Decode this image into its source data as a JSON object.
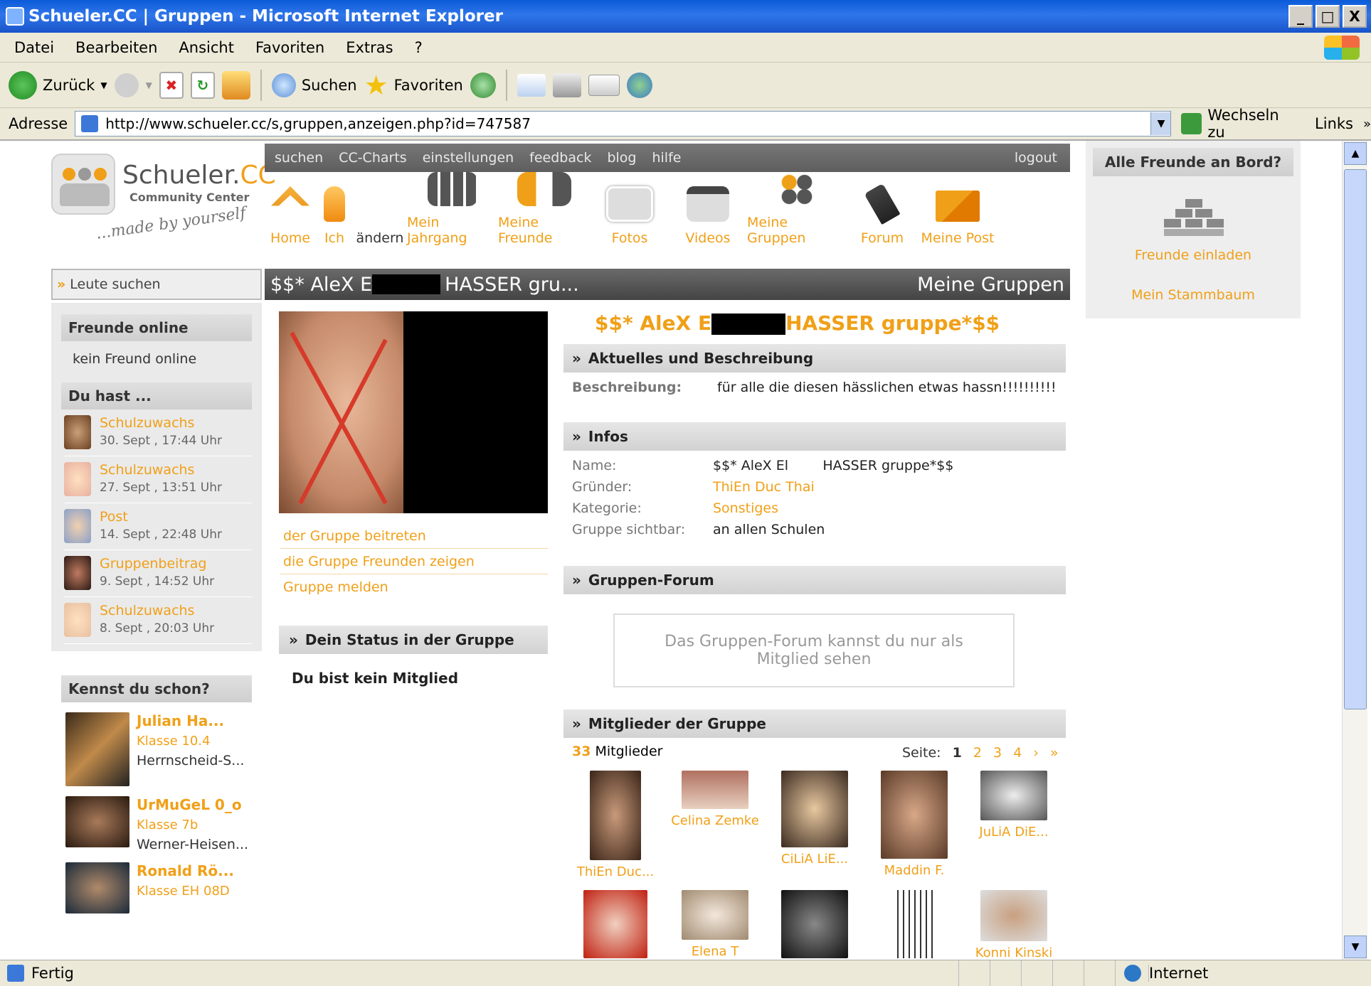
{
  "window": {
    "title": "Schueler.CC | Gruppen - Microsoft Internet Explorer",
    "min": "_",
    "max": "□",
    "close": "X"
  },
  "menu": [
    "Datei",
    "Bearbeiten",
    "Ansicht",
    "Favoriten",
    "Extras",
    "?"
  ],
  "toolbar": {
    "back": "Zurück",
    "search": "Suchen",
    "favorites": "Favoriten"
  },
  "address": {
    "label": "Adresse",
    "url": "http://www.schueler.cc/s,gruppen,anzeigen.php?id=747587",
    "go": "Wechseln zu",
    "links": "Links"
  },
  "status": {
    "text": "Fertig",
    "zone": "Internet"
  },
  "site": {
    "logo": {
      "name": "Schueler.",
      "cc": "CC",
      "sub": "Community Center",
      "slogan": "...made by yourself"
    },
    "topnav": [
      "suchen",
      "CC-Charts",
      "einstellungen",
      "feedback",
      "blog",
      "hilfe"
    ],
    "logout": "logout",
    "iconnav": [
      "Home",
      "Ich",
      "ändern",
      "Mein Jahrgang",
      "Meine Freunde",
      "Fotos",
      "Videos",
      "Meine Gruppen",
      "Forum",
      "Meine Post"
    ],
    "search_placeholder": "Leute suchen",
    "header_title_a": "$$* AleX E",
    "header_title_b": "HASSER gru...",
    "header_right": "Meine Gruppen"
  },
  "left": {
    "online_title": "Freunde online",
    "online_text": "kein Freund online",
    "duhast_title": "Du hast ...",
    "activities": [
      {
        "type": "Schulzuwachs",
        "time": "30. Sept , 17:44 Uhr"
      },
      {
        "type": "Schulzuwachs",
        "time": "27. Sept , 13:51 Uhr"
      },
      {
        "type": "Post",
        "time": "14. Sept , 22:48 Uhr"
      },
      {
        "type": "Gruppenbeitrag",
        "time": "9. Sept , 14:52 Uhr"
      },
      {
        "type": "Schulzuwachs",
        "time": "8. Sept , 20:03 Uhr"
      }
    ],
    "kennst_title": "Kennst du schon?",
    "people": [
      {
        "name": "Julian Ha...",
        "klasse": "Klasse 10.4",
        "school": "Herrnscheid-S..."
      },
      {
        "name": "UrMuGeL 0_o",
        "klasse": "Klasse 7b",
        "school": "Werner-Heisen..."
      },
      {
        "name": "Ronald Rö...",
        "klasse": "Klasse EH 08D",
        "school": ""
      }
    ]
  },
  "center": {
    "links": [
      "der Gruppe beitreten",
      "die Gruppe Freunden zeigen",
      "Gruppe melden"
    ],
    "status_title": "Dein Status in der Gruppe",
    "status_text": "Du bist kein Mitglied"
  },
  "group": {
    "title_a": "$$* AleX E",
    "title_b": "HASSER gruppe*$$",
    "aktuelles_title": "Aktuelles und Beschreibung",
    "desc_label": "Beschreibung:",
    "desc_value": "für alle die diesen hässlichen etwas hassn!!!!!!!!!!",
    "infos_title": "Infos",
    "infos": [
      {
        "k": "Name:",
        "v": "$$* AleX El        HASSER gruppe*$$"
      },
      {
        "k": "Gründer:",
        "v": "ThiEn Duc Thai"
      },
      {
        "k": "Kategorie:",
        "v": "Sonstiges"
      },
      {
        "k": "Gruppe sichtbar:",
        "v": "an allen Schulen"
      }
    ],
    "forum_title": "Gruppen-Forum",
    "forum_text": "Das Gruppen-Forum kannst du nur als Mitglied sehen",
    "members_title": "Mitglieder der Gruppe",
    "member_count": "33",
    "member_label": "Mitglieder",
    "page_label": "Seite:",
    "pages": [
      "1",
      "2",
      "3",
      "4",
      "›",
      "»"
    ],
    "members": [
      "ThiEn Duc...",
      "Celina Zemke",
      "CiLiA LiE...",
      "Maddin F.",
      "JuLiA DiE...",
      "",
      "Elena T",
      "",
      "",
      "Konni Kinski"
    ]
  },
  "right": {
    "title": "Alle Freunde an Bord?",
    "invite": "Freunde einladen",
    "tree": "Mein Stammbaum"
  }
}
